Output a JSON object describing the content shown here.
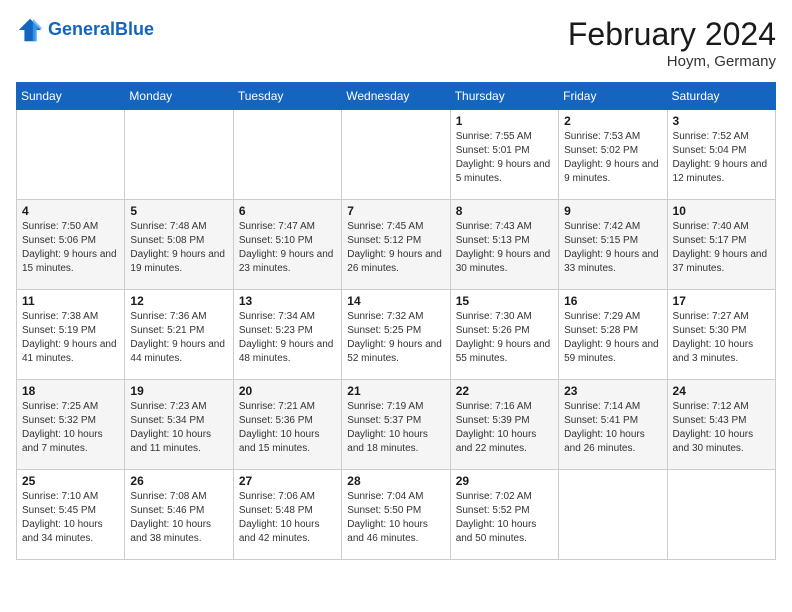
{
  "logo": {
    "text_general": "General",
    "text_blue": "Blue"
  },
  "title": "February 2024",
  "location": "Hoym, Germany",
  "weekdays": [
    "Sunday",
    "Monday",
    "Tuesday",
    "Wednesday",
    "Thursday",
    "Friday",
    "Saturday"
  ],
  "weeks": [
    [
      {
        "day": "",
        "info": ""
      },
      {
        "day": "",
        "info": ""
      },
      {
        "day": "",
        "info": ""
      },
      {
        "day": "",
        "info": ""
      },
      {
        "day": "1",
        "info": "Sunrise: 7:55 AM\nSunset: 5:01 PM\nDaylight: 9 hours and 5 minutes."
      },
      {
        "day": "2",
        "info": "Sunrise: 7:53 AM\nSunset: 5:02 PM\nDaylight: 9 hours and 9 minutes."
      },
      {
        "day": "3",
        "info": "Sunrise: 7:52 AM\nSunset: 5:04 PM\nDaylight: 9 hours and 12 minutes."
      }
    ],
    [
      {
        "day": "4",
        "info": "Sunrise: 7:50 AM\nSunset: 5:06 PM\nDaylight: 9 hours and 15 minutes."
      },
      {
        "day": "5",
        "info": "Sunrise: 7:48 AM\nSunset: 5:08 PM\nDaylight: 9 hours and 19 minutes."
      },
      {
        "day": "6",
        "info": "Sunrise: 7:47 AM\nSunset: 5:10 PM\nDaylight: 9 hours and 23 minutes."
      },
      {
        "day": "7",
        "info": "Sunrise: 7:45 AM\nSunset: 5:12 PM\nDaylight: 9 hours and 26 minutes."
      },
      {
        "day": "8",
        "info": "Sunrise: 7:43 AM\nSunset: 5:13 PM\nDaylight: 9 hours and 30 minutes."
      },
      {
        "day": "9",
        "info": "Sunrise: 7:42 AM\nSunset: 5:15 PM\nDaylight: 9 hours and 33 minutes."
      },
      {
        "day": "10",
        "info": "Sunrise: 7:40 AM\nSunset: 5:17 PM\nDaylight: 9 hours and 37 minutes."
      }
    ],
    [
      {
        "day": "11",
        "info": "Sunrise: 7:38 AM\nSunset: 5:19 PM\nDaylight: 9 hours and 41 minutes."
      },
      {
        "day": "12",
        "info": "Sunrise: 7:36 AM\nSunset: 5:21 PM\nDaylight: 9 hours and 44 minutes."
      },
      {
        "day": "13",
        "info": "Sunrise: 7:34 AM\nSunset: 5:23 PM\nDaylight: 9 hours and 48 minutes."
      },
      {
        "day": "14",
        "info": "Sunrise: 7:32 AM\nSunset: 5:25 PM\nDaylight: 9 hours and 52 minutes."
      },
      {
        "day": "15",
        "info": "Sunrise: 7:30 AM\nSunset: 5:26 PM\nDaylight: 9 hours and 55 minutes."
      },
      {
        "day": "16",
        "info": "Sunrise: 7:29 AM\nSunset: 5:28 PM\nDaylight: 9 hours and 59 minutes."
      },
      {
        "day": "17",
        "info": "Sunrise: 7:27 AM\nSunset: 5:30 PM\nDaylight: 10 hours and 3 minutes."
      }
    ],
    [
      {
        "day": "18",
        "info": "Sunrise: 7:25 AM\nSunset: 5:32 PM\nDaylight: 10 hours and 7 minutes."
      },
      {
        "day": "19",
        "info": "Sunrise: 7:23 AM\nSunset: 5:34 PM\nDaylight: 10 hours and 11 minutes."
      },
      {
        "day": "20",
        "info": "Sunrise: 7:21 AM\nSunset: 5:36 PM\nDaylight: 10 hours and 15 minutes."
      },
      {
        "day": "21",
        "info": "Sunrise: 7:19 AM\nSunset: 5:37 PM\nDaylight: 10 hours and 18 minutes."
      },
      {
        "day": "22",
        "info": "Sunrise: 7:16 AM\nSunset: 5:39 PM\nDaylight: 10 hours and 22 minutes."
      },
      {
        "day": "23",
        "info": "Sunrise: 7:14 AM\nSunset: 5:41 PM\nDaylight: 10 hours and 26 minutes."
      },
      {
        "day": "24",
        "info": "Sunrise: 7:12 AM\nSunset: 5:43 PM\nDaylight: 10 hours and 30 minutes."
      }
    ],
    [
      {
        "day": "25",
        "info": "Sunrise: 7:10 AM\nSunset: 5:45 PM\nDaylight: 10 hours and 34 minutes."
      },
      {
        "day": "26",
        "info": "Sunrise: 7:08 AM\nSunset: 5:46 PM\nDaylight: 10 hours and 38 minutes."
      },
      {
        "day": "27",
        "info": "Sunrise: 7:06 AM\nSunset: 5:48 PM\nDaylight: 10 hours and 42 minutes."
      },
      {
        "day": "28",
        "info": "Sunrise: 7:04 AM\nSunset: 5:50 PM\nDaylight: 10 hours and 46 minutes."
      },
      {
        "day": "29",
        "info": "Sunrise: 7:02 AM\nSunset: 5:52 PM\nDaylight: 10 hours and 50 minutes."
      },
      {
        "day": "",
        "info": ""
      },
      {
        "day": "",
        "info": ""
      }
    ]
  ]
}
